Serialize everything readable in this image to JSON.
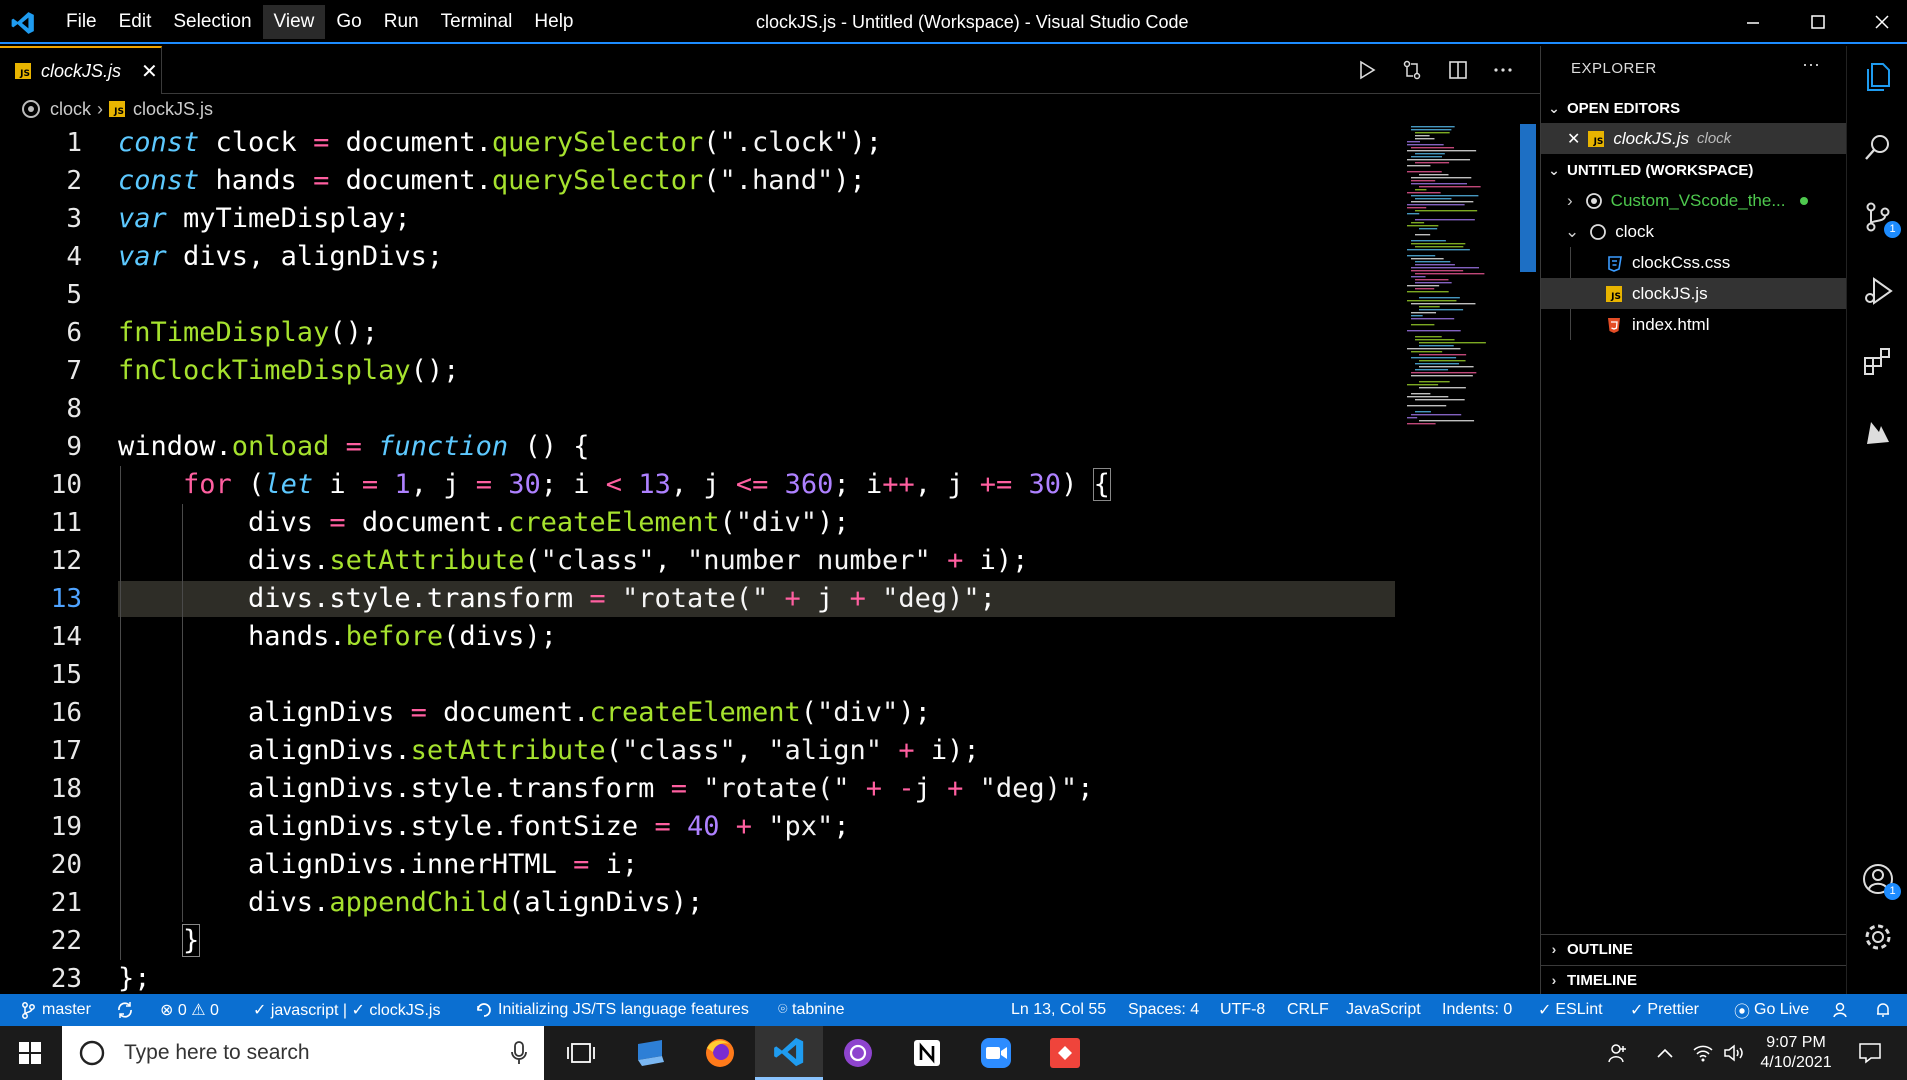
{
  "window": {
    "title": "clockJS.js - Untitled (Workspace) - Visual Studio Code"
  },
  "menu": [
    "File",
    "Edit",
    "Selection",
    "View",
    "Go",
    "Run",
    "Terminal",
    "Help"
  ],
  "tab": {
    "name": "clockJS.js",
    "close": "✕",
    "badge": "JS"
  },
  "breadcrumb": {
    "folder": "clock",
    "file": "clockJS.js"
  },
  "editor": {
    "active_line": 13,
    "line_numbers": [
      "1",
      "2",
      "3",
      "4",
      "5",
      "6",
      "7",
      "8",
      "9",
      "10",
      "11",
      "12",
      "13",
      "14",
      "15",
      "16",
      "17",
      "18",
      "19",
      "20",
      "21",
      "22",
      "23"
    ],
    "lines": [
      [
        [
          "kw",
          "const"
        ],
        [
          "id",
          " clock "
        ],
        [
          "op",
          "="
        ],
        [
          "id",
          " document."
        ],
        [
          "fn",
          "querySelector"
        ],
        [
          "pn",
          "("
        ],
        [
          "str",
          "\".clock\""
        ],
        [
          "pn",
          ");"
        ]
      ],
      [
        [
          "kw",
          "const"
        ],
        [
          "id",
          " hands "
        ],
        [
          "op",
          "="
        ],
        [
          "id",
          " document."
        ],
        [
          "fn",
          "querySelector"
        ],
        [
          "pn",
          "("
        ],
        [
          "str",
          "\".hand\""
        ],
        [
          "pn",
          ");"
        ]
      ],
      [
        [
          "kw",
          "var"
        ],
        [
          "id",
          " myTimeDisplay;"
        ]
      ],
      [
        [
          "kw",
          "var"
        ],
        [
          "id",
          " divs, alignDivs;"
        ]
      ],
      [],
      [
        [
          "fn",
          "fnTimeDisplay"
        ],
        [
          "pn",
          "();"
        ]
      ],
      [
        [
          "fn",
          "fnClockTimeDisplay"
        ],
        [
          "pn",
          "();"
        ]
      ],
      [],
      [
        [
          "id",
          "window."
        ],
        [
          "fn",
          "onload"
        ],
        [
          "id",
          " "
        ],
        [
          "op",
          "="
        ],
        [
          "id",
          " "
        ],
        [
          "kw",
          "function"
        ],
        [
          "pn",
          " () {"
        ]
      ],
      [
        [
          "id",
          "    "
        ],
        [
          "ctl",
          "for"
        ],
        [
          "pn",
          " ("
        ],
        [
          "kw",
          "let"
        ],
        [
          "id",
          " i "
        ],
        [
          "op",
          "="
        ],
        [
          "id",
          " "
        ],
        [
          "num",
          "1"
        ],
        [
          "pn",
          ", "
        ],
        [
          "id",
          "j "
        ],
        [
          "op",
          "="
        ],
        [
          "id",
          " "
        ],
        [
          "num",
          "30"
        ],
        [
          "pn",
          "; "
        ],
        [
          "id",
          "i "
        ],
        [
          "op",
          "<"
        ],
        [
          "id",
          " "
        ],
        [
          "num",
          "13"
        ],
        [
          "pn",
          ", "
        ],
        [
          "id",
          "j "
        ],
        [
          "op",
          "<="
        ],
        [
          "id",
          " "
        ],
        [
          "num",
          "360"
        ],
        [
          "pn",
          "; "
        ],
        [
          "id",
          "i"
        ],
        [
          "op",
          "++"
        ],
        [
          "pn",
          ", "
        ],
        [
          "id",
          "j "
        ],
        [
          "op",
          "+="
        ],
        [
          "id",
          " "
        ],
        [
          "num",
          "30"
        ],
        [
          "pn",
          ") "
        ],
        [
          "br",
          "{"
        ]
      ],
      [
        [
          "id",
          "        divs "
        ],
        [
          "op",
          "="
        ],
        [
          "id",
          " document."
        ],
        [
          "fn",
          "createElement"
        ],
        [
          "pn",
          "("
        ],
        [
          "str",
          "\"div\""
        ],
        [
          "pn",
          ");"
        ]
      ],
      [
        [
          "id",
          "        divs."
        ],
        [
          "fn",
          "setAttribute"
        ],
        [
          "pn",
          "("
        ],
        [
          "str",
          "\"class\""
        ],
        [
          "pn",
          ", "
        ],
        [
          "str",
          "\"number number\""
        ],
        [
          "id",
          " "
        ],
        [
          "op",
          "+"
        ],
        [
          "id",
          " i"
        ],
        [
          "pn",
          ");"
        ]
      ],
      [
        [
          "id",
          "        divs.style.transform "
        ],
        [
          "op",
          "="
        ],
        [
          "id",
          " "
        ],
        [
          "str",
          "\"rotate(\""
        ],
        [
          "id",
          " "
        ],
        [
          "op",
          "+"
        ],
        [
          "id",
          " j "
        ],
        [
          "op",
          "+"
        ],
        [
          "id",
          " "
        ],
        [
          "str",
          "\"deg)\""
        ],
        [
          "pn",
          ";"
        ]
      ],
      [
        [
          "id",
          "        hands."
        ],
        [
          "fn",
          "before"
        ],
        [
          "pn",
          "("
        ],
        [
          "id",
          "divs"
        ],
        [
          "pn",
          ");"
        ]
      ],
      [],
      [
        [
          "id",
          "        alignDivs "
        ],
        [
          "op",
          "="
        ],
        [
          "id",
          " document."
        ],
        [
          "fn",
          "createElement"
        ],
        [
          "pn",
          "("
        ],
        [
          "str",
          "\"div\""
        ],
        [
          "pn",
          ");"
        ]
      ],
      [
        [
          "id",
          "        alignDivs."
        ],
        [
          "fn",
          "setAttribute"
        ],
        [
          "pn",
          "("
        ],
        [
          "str",
          "\"class\""
        ],
        [
          "pn",
          ", "
        ],
        [
          "str",
          "\"align\""
        ],
        [
          "id",
          " "
        ],
        [
          "op",
          "+"
        ],
        [
          "id",
          " i"
        ],
        [
          "pn",
          ");"
        ]
      ],
      [
        [
          "id",
          "        alignDivs.style.transform "
        ],
        [
          "op",
          "="
        ],
        [
          "id",
          " "
        ],
        [
          "str",
          "\"rotate(\""
        ],
        [
          "id",
          " "
        ],
        [
          "op",
          "+"
        ],
        [
          "id",
          " "
        ],
        [
          "op",
          "-"
        ],
        [
          "id",
          "j "
        ],
        [
          "op",
          "+"
        ],
        [
          "id",
          " "
        ],
        [
          "str",
          "\"deg)\""
        ],
        [
          "pn",
          ";"
        ]
      ],
      [
        [
          "id",
          "        alignDivs.style.fontSize "
        ],
        [
          "op",
          "="
        ],
        [
          "id",
          " "
        ],
        [
          "num",
          "40"
        ],
        [
          "id",
          " "
        ],
        [
          "op",
          "+"
        ],
        [
          "id",
          " "
        ],
        [
          "str",
          "\"px\""
        ],
        [
          "pn",
          ";"
        ]
      ],
      [
        [
          "id",
          "        alignDivs.innerHTML "
        ],
        [
          "op",
          "="
        ],
        [
          "id",
          " i;"
        ]
      ],
      [
        [
          "id",
          "        divs."
        ],
        [
          "fn",
          "appendChild"
        ],
        [
          "pn",
          "("
        ],
        [
          "id",
          "alignDivs"
        ],
        [
          "pn",
          ");"
        ]
      ],
      [
        [
          "id",
          "    "
        ],
        [
          "br",
          "}"
        ]
      ],
      [
        [
          "pn",
          "};"
        ]
      ]
    ]
  },
  "explorer": {
    "title": "EXPLORER",
    "more": "···",
    "open_editors": {
      "label": "OPEN EDITORS",
      "items": [
        {
          "name": "clockJS.js",
          "desc": "clock"
        }
      ]
    },
    "workspace": {
      "label": "UNTITLED (WORKSPACE)",
      "folders": [
        {
          "name": "Custom_VScode_the...",
          "color": "#4ec94e"
        },
        {
          "name": "clock"
        }
      ],
      "files": [
        {
          "name": "clockCss.css",
          "icon": "css-icon"
        },
        {
          "name": "clockJS.js",
          "icon": "js-icon"
        },
        {
          "name": "index.html",
          "icon": "html-icon"
        }
      ]
    },
    "outline": "OUTLINE",
    "timeline": "TIMELINE"
  },
  "activity": {
    "scm_badge": "1",
    "account_badge": "1"
  },
  "status": {
    "branch": "master",
    "problems": "⊗ 0 ⚠ 0",
    "check": "✓ javascript | ✓ clockJS.js",
    "init": "Initializing JS/TS language features",
    "tabnine": "⌾ tabnine",
    "position": "Ln 13, Col 55",
    "spaces": "Spaces: 4",
    "encoding": "UTF-8",
    "eol": "CRLF",
    "language": "JavaScript",
    "indents": "Indents: 0",
    "eslint": "ESLint",
    "prettier": "Prettier",
    "golive": "Go Live"
  },
  "taskbar": {
    "search_placeholder": "Type here to search",
    "time": "9:07 PM",
    "date": "4/10/2021"
  },
  "colors": {
    "accent": "#1d8cff",
    "statusbar": "#0b6fd1",
    "keyword": "#5dc9ff",
    "function": "#a6e22e",
    "operator": "#ff5fa0",
    "number": "#ae81ff"
  }
}
